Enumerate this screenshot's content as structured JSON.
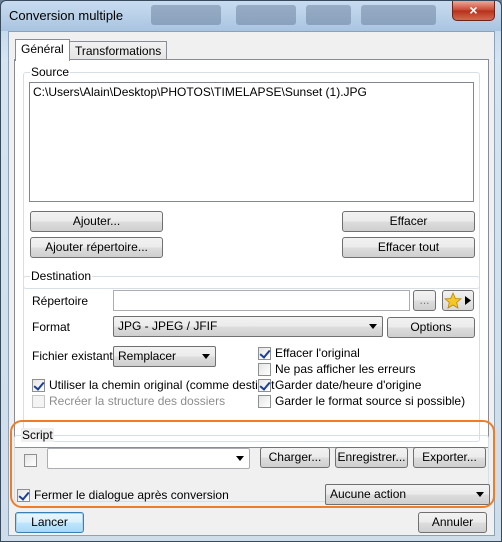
{
  "window": {
    "title": "Conversion multiple",
    "close_label": "×"
  },
  "tabs": [
    {
      "label": "Général",
      "active": true
    },
    {
      "label": "Transformations",
      "active": false
    }
  ],
  "source": {
    "label": "Source",
    "files": [
      "C:\\Users\\Alain\\Desktop\\PHOTOS\\TIMELAPSE\\Sunset (1).JPG"
    ],
    "add_label": "Ajouter...",
    "add_dir_label": "Ajouter répertoire...",
    "clear_label": "Effacer",
    "clear_all_label": "Effacer tout"
  },
  "destination": {
    "label": "Destination",
    "directory_label": "Répertoire",
    "directory_value": "",
    "browse_label": "...",
    "format_label": "Format",
    "format_value": "JPG - JPEG / JFIF",
    "options_label": "Options",
    "existing_label": "Fichier existant",
    "existing_value": "Remplacer",
    "use_original_path": {
      "label": "Utiliser la chemin original (comme destinat",
      "checked": true
    },
    "recreate_structure": {
      "label": "Recréer la structure des dossiers",
      "checked": false,
      "disabled": true
    },
    "delete_original": {
      "label": "Effacer l'original",
      "checked": true
    },
    "hide_errors": {
      "label": "Ne pas afficher les erreurs",
      "checked": false
    },
    "keep_date": {
      "label": "Garder date/heure d'origine",
      "checked": true
    },
    "keep_format": {
      "label": "Garder le format source si possible)",
      "checked": false
    }
  },
  "script": {
    "label": "Script",
    "enabled": false,
    "value": "",
    "load_label": "Charger...",
    "save_label": "Enregistrer...",
    "export_label": "Exporter..."
  },
  "close_after": {
    "label": "Fermer le dialogue après conversion",
    "checked": true
  },
  "after_action": {
    "value": "Aucune action"
  },
  "footer": {
    "run_label": "Lancer",
    "cancel_label": "Annuler"
  },
  "colors": {
    "highlight": "#ef7d28",
    "accent": "#3c7fb1"
  }
}
